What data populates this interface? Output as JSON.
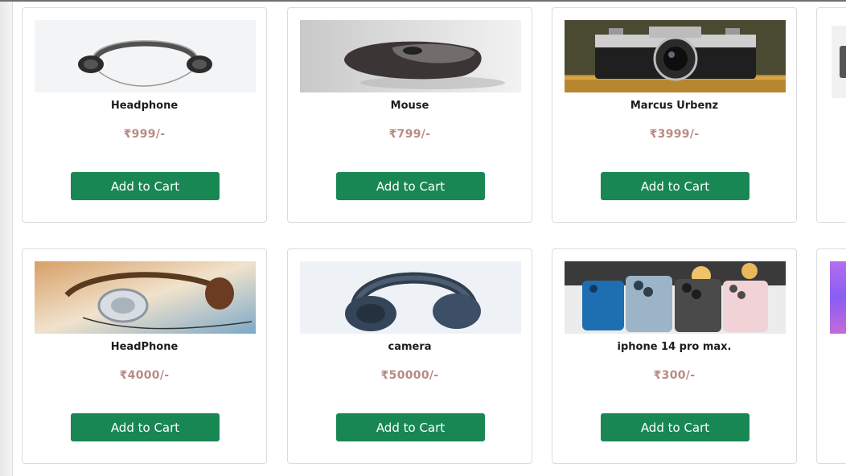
{
  "products": [
    {
      "name": "Headphone",
      "price": "₹999/-",
      "button": "Add to Cart",
      "image": "headphone-image"
    },
    {
      "name": "Mouse",
      "price": "₹799/-",
      "button": "Add to Cart",
      "image": "mouse-image"
    },
    {
      "name": "Marcus Urbenz",
      "price": "₹3999/-",
      "button": "Add to Cart",
      "image": "camera-image"
    },
    {
      "name": "HeadPhone",
      "price": "₹4000/-",
      "button": "Add to Cart",
      "image": "headphone-image"
    },
    {
      "name": "camera",
      "price": "₹50000/-",
      "button": "Add to Cart",
      "image": "headphone-image"
    },
    {
      "name": "iphone 14 pro max.",
      "price": "₹300/-",
      "button": "Add to Cart",
      "image": "phones-image"
    }
  ],
  "colors": {
    "button_bg": "#198754",
    "price_text": "#b98a84",
    "card_border": "#dcdcdc"
  }
}
